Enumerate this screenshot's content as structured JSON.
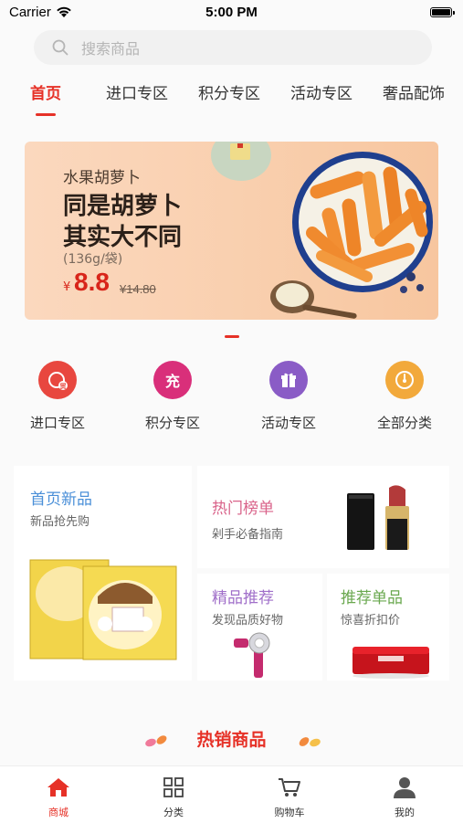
{
  "status_bar": {
    "carrier": "Carrier",
    "time": "5:00 PM"
  },
  "search": {
    "placeholder": "搜索商品"
  },
  "tabs": [
    {
      "label": "首页",
      "active": true
    },
    {
      "label": "进口专区"
    },
    {
      "label": "积分专区"
    },
    {
      "label": "活动专区"
    },
    {
      "label": "奢品配饰"
    }
  ],
  "banner": {
    "subtitle": "水果胡萝卜",
    "title_line1": "同是胡萝卜",
    "title_line2": "其实大不同",
    "spec": "(136g/袋)",
    "currency": "¥",
    "price": "8.8",
    "original_price": "¥14.80"
  },
  "categories": [
    {
      "label": "进口专区",
      "icon": "import-icon",
      "color": "#e8473f"
    },
    {
      "label": "积分专区",
      "icon": "points-icon",
      "glyph": "充",
      "color": "#d92f7a"
    },
    {
      "label": "活动专区",
      "icon": "gift-icon",
      "color": "#8a5cc6"
    },
    {
      "label": "全部分类",
      "icon": "dashboard-icon",
      "color": "#f2a93b"
    }
  ],
  "promo": {
    "new": {
      "title": "首页新品",
      "sub": "新品抢先购",
      "color": "#4a8fd8"
    },
    "hot": {
      "title": "热门榜单",
      "sub": "剁手必备指南",
      "color": "#d9638a"
    },
    "featured": {
      "title": "精品推荐",
      "sub": "发现品质好物",
      "color": "#a06fc9"
    },
    "single": {
      "title": "推荐单品",
      "sub": "惊喜折扣价",
      "color": "#6aa84f"
    }
  },
  "hot_section": {
    "title": "热销商品"
  },
  "tabbar": [
    {
      "label": "商城",
      "icon": "home-icon",
      "active": true
    },
    {
      "label": "分类",
      "icon": "grid-icon"
    },
    {
      "label": "购物车",
      "icon": "cart-icon"
    },
    {
      "label": "我的",
      "icon": "user-icon"
    }
  ],
  "colors": {
    "accent": "#e63127"
  }
}
